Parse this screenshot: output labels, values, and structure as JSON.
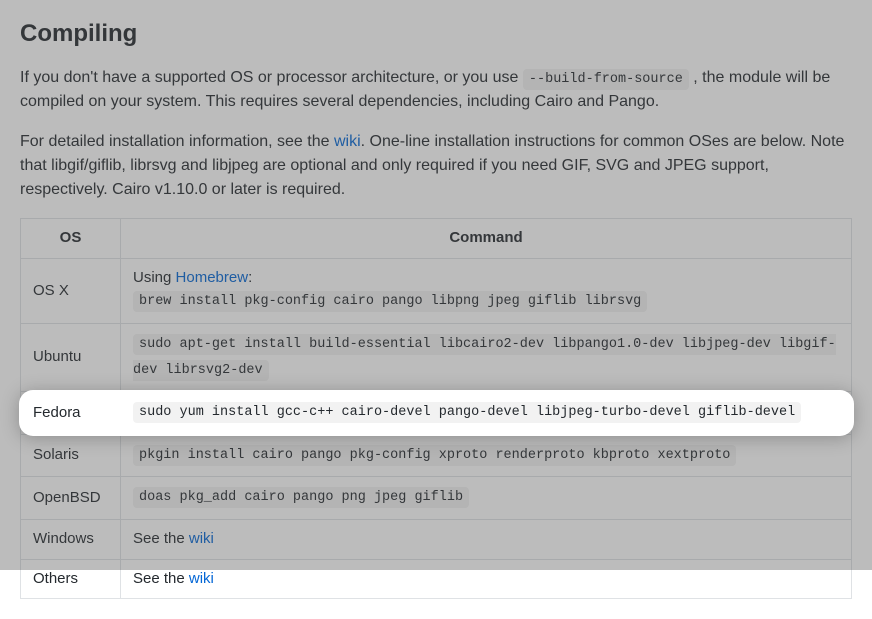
{
  "heading": "Compiling",
  "para1_before_code": "If you don't have a supported OS or processor architecture, or you use ",
  "para1_code": "--build-from-source",
  "para1_after_code": " , the module will be compiled on your system. This requires several dependencies, including Cairo and Pango.",
  "para2_before_link": "For detailed installation information, see the ",
  "para2_link": "wiki",
  "para2_after_link": ". One-line installation instructions for common OSes are below. Note that libgif/giflib, librsvg and libjpeg are optional and only required if you need GIF, SVG and JPEG support, respectively. Cairo v1.10.0 or later is required.",
  "table": {
    "headers": {
      "os": "OS",
      "command": "Command"
    },
    "rows": {
      "osx": {
        "os": "OS X",
        "prefix": "Using ",
        "link": "Homebrew",
        "suffix": ":",
        "cmd": "brew install pkg-config cairo pango libpng jpeg giflib librsvg"
      },
      "ubuntu": {
        "os": "Ubuntu",
        "cmd": "sudo apt-get install build-essential libcairo2-dev libpango1.0-dev libjpeg-dev libgif-dev librsvg2-dev"
      },
      "fedora": {
        "os": "Fedora",
        "cmd": "sudo yum install gcc-c++ cairo-devel pango-devel libjpeg-turbo-devel giflib-devel"
      },
      "solaris": {
        "os": "Solaris",
        "cmd": "pkgin install cairo pango pkg-config xproto renderproto kbproto xextproto"
      },
      "openbsd": {
        "os": "OpenBSD",
        "cmd": "doas pkg_add cairo pango png jpeg giflib"
      },
      "windows": {
        "os": "Windows",
        "prefix": "See the ",
        "link": "wiki"
      },
      "others": {
        "os": "Others",
        "prefix": "See the ",
        "link": "wiki"
      }
    }
  }
}
